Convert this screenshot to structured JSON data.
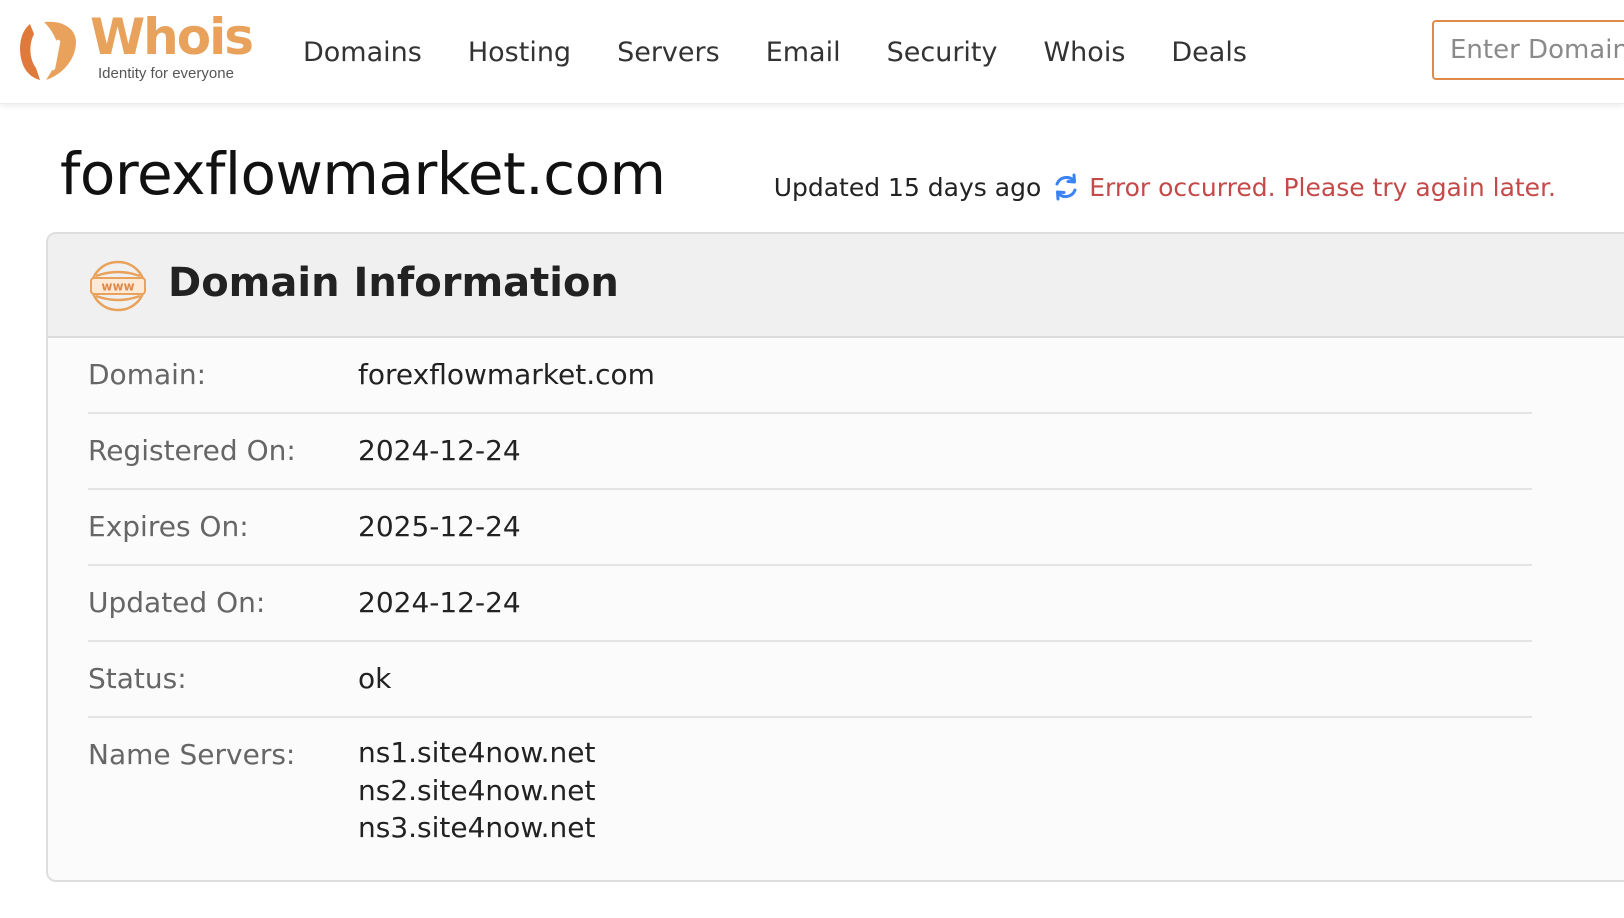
{
  "header": {
    "logo": {
      "word": "Whois",
      "tagline": "Identity for everyone",
      "icon": "whois-logo-icon"
    },
    "nav": [
      {
        "label": "Domains"
      },
      {
        "label": "Hosting"
      },
      {
        "label": "Servers"
      },
      {
        "label": "Email"
      },
      {
        "label": "Security"
      },
      {
        "label": "Whois"
      },
      {
        "label": "Deals"
      }
    ],
    "search": {
      "placeholder": "Enter Domain or IP",
      "value": ""
    }
  },
  "page": {
    "title": "forexflowmarket.com",
    "updated": "Updated 15 days ago",
    "refresh_icon": "refresh-icon",
    "error": "Error occurred. Please try again later."
  },
  "domain_info": {
    "title": "Domain Information",
    "icon": "www-icon",
    "rows": [
      {
        "label": "Domain:",
        "value": "forexflowmarket.com"
      },
      {
        "label": "Registered On:",
        "value": "2024-12-24"
      },
      {
        "label": "Expires On:",
        "value": "2025-12-24"
      },
      {
        "label": "Updated On:",
        "value": "2024-12-24"
      },
      {
        "label": "Status:",
        "value": "ok"
      }
    ],
    "name_servers": {
      "label": "Name Servers:",
      "values": [
        "ns1.site4now.net",
        "ns2.site4now.net",
        "ns3.site4now.net"
      ]
    }
  },
  "colors": {
    "brand_orange": "#e8a25c",
    "brand_dark_orange": "#e07a3a",
    "search_border": "#e08a4a",
    "error_red": "#c44a4a",
    "refresh_blue": "#3b82f6"
  }
}
